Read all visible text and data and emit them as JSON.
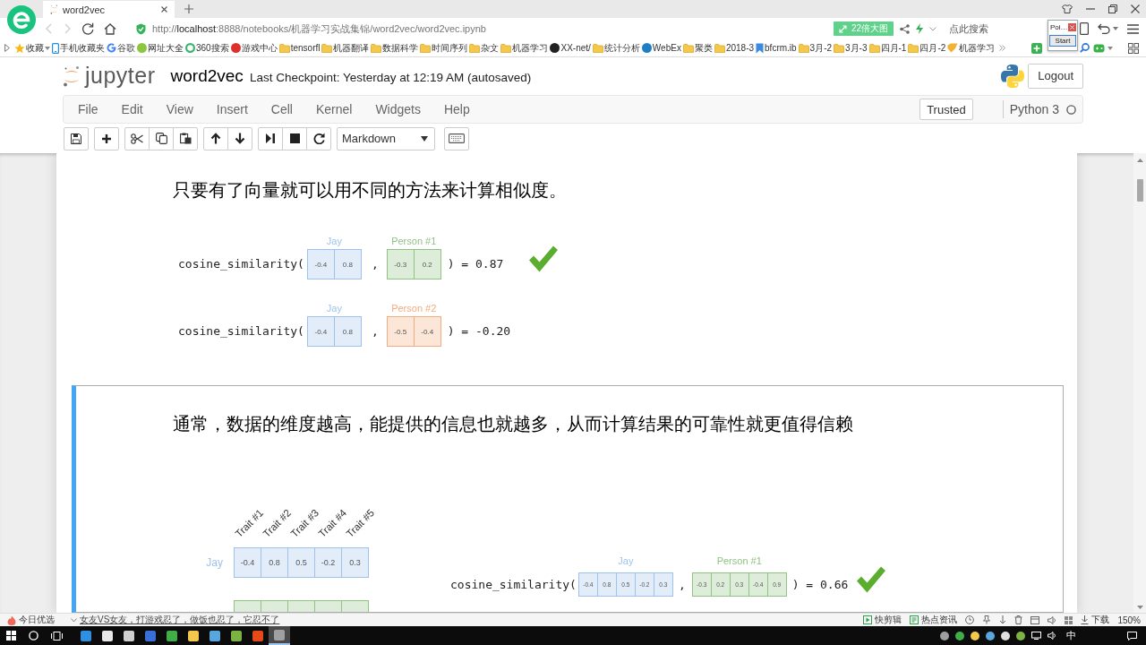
{
  "browser": {
    "tabs": [
      {
        "title": "word2vec",
        "selected": true
      }
    ],
    "navigation": {
      "back_disabled": true,
      "forward_disabled": true
    },
    "url": "http://**localhost**:8888/notebooks/机器学习实战集锦/word2vec/word2vec.ipynb",
    "promo": "22倍大图",
    "search": {
      "placeholder": "点此搜索"
    },
    "popup": {
      "title": "Poi…",
      "button": "Start"
    },
    "bookmarks": [
      {
        "kind": "star",
        "label": "收藏"
      },
      {
        "kind": "phone",
        "label": "手机收藏夹"
      },
      {
        "kind": "google",
        "label": "谷歌"
      },
      {
        "kind": "site",
        "label": "网址大全",
        "color": "#8cc63f"
      },
      {
        "kind": "ring",
        "label": "360搜索",
        "color": "#3cb371"
      },
      {
        "kind": "site",
        "label": "游戏中心",
        "color": "#e0302c"
      },
      {
        "kind": "folder",
        "label": "tensorfl"
      },
      {
        "kind": "folder",
        "label": "机器翻译"
      },
      {
        "kind": "folder",
        "label": "数据科学"
      },
      {
        "kind": "folder",
        "label": "时间序列"
      },
      {
        "kind": "folder",
        "label": "杂文"
      },
      {
        "kind": "folder",
        "label": "机器学习"
      },
      {
        "kind": "site",
        "label": "XX-net/",
        "color": "#222222"
      },
      {
        "kind": "folder",
        "label": "统计分析"
      },
      {
        "kind": "site",
        "label": "WebEx",
        "color": "#1f7fc4"
      },
      {
        "kind": "folder",
        "label": "聚类"
      },
      {
        "kind": "folder",
        "label": "2018-3"
      },
      {
        "kind": "ribbon",
        "label": "bfcrm.ib"
      },
      {
        "kind": "folder",
        "label": "3月-2"
      },
      {
        "kind": "folder",
        "label": "3月-3"
      },
      {
        "kind": "folder",
        "label": "四月-1"
      },
      {
        "kind": "folder",
        "label": "四月-2"
      },
      {
        "kind": "tag",
        "label": "机器学习"
      }
    ]
  },
  "notebook": {
    "logo": "jupyter",
    "name": "word2vec",
    "checkpoint": "Last Checkpoint: Yesterday at 12:19 AM (autosaved)",
    "logout": "Logout",
    "menu": [
      "File",
      "Edit",
      "View",
      "Insert",
      "Cell",
      "Kernel",
      "Widgets",
      "Help"
    ],
    "trusted": "Trusted",
    "kernel": {
      "name": "Python 3",
      "busy": false
    },
    "cell_type": "Markdown",
    "cells": [
      {
        "selected": false,
        "text": "只要有了向量就可以用不同的方法来计算相似度。",
        "figure": {
          "kind": "comparison",
          "rows": [
            {
              "function": "cosine_similarity(",
              "vectors": [
                {
                  "name": "Jay",
                  "color": "#9dc3ec",
                  "values": [
                    "-0.4",
                    "0.8"
                  ]
                },
                {
                  "name": "Person #1",
                  "color": "#8fc283",
                  "values": [
                    "-0.3",
                    "0.2"
                  ]
                }
              ],
              "separator": ",",
              "result": ") = 0.87",
              "match": true
            },
            {
              "function": "cosine_similarity(",
              "vectors": [
                {
                  "name": "Jay",
                  "color": "#9dc3ec",
                  "values": [
                    "-0.4",
                    "0.8"
                  ]
                },
                {
                  "name": "Person #2",
                  "color": "#f2ac7e",
                  "values": [
                    "-0.5",
                    "-0.4"
                  ]
                }
              ],
              "separator": ",",
              "result": ") = -0.20",
              "match": false
            }
          ]
        }
      },
      {
        "selected": true,
        "text": "通常，数据的维度越高，能提供的信息也就越多，从而计算结果的可靠性就更值得信赖",
        "figure": {
          "kind": "traits",
          "traits": [
            "Trait #1",
            "Trait #2",
            "Trait #3",
            "Trait #4",
            "Trait #5"
          ],
          "rows": [
            {
              "name": "Jay",
              "color": "#9dc3ec",
              "values": [
                "-0.4",
                "0.8",
                "0.5",
                "-0.2",
                "0.3"
              ]
            },
            {
              "color": "#8fc283"
            }
          ],
          "comparison": {
            "function": "cosine_similarity(",
            "vectors": [
              {
                "name": "Jay",
                "color": "#9dc3ec",
                "values": [
                  "-0.4",
                  "0.8",
                  "0.5",
                  "-0.2",
                  "0.3"
                ]
              },
              {
                "name": "Person #1",
                "color": "#8fc283",
                "values": [
                  "-0.3",
                  "0.2",
                  "0.3",
                  "-0.4",
                  "0.9"
                ]
              }
            ],
            "separator": ",",
            "result": ") = 0.66",
            "match": true
          }
        }
      }
    ]
  },
  "status_bar": {
    "left": [
      {
        "kind": "feed",
        "text": "今日优选"
      },
      {
        "kind": "headline",
        "text": "女友VS女友，打游戏忍了，做饭也忍了，它忍不了"
      }
    ],
    "right": [
      {
        "kind": "clip",
        "text": "快剪辑"
      },
      {
        "kind": "news",
        "text": "热点资讯"
      },
      {
        "kind": "download",
        "text": "下载"
      },
      {
        "kind": "zoom",
        "text": "150%"
      }
    ]
  },
  "taskbar": {
    "apps": [
      {
        "color": "#2f8fe0",
        "selected": false
      },
      {
        "color": "#e8e8e8",
        "selected": false
      },
      {
        "color": "#d0d0d0",
        "selected": false
      },
      {
        "color": "#3b6fd8",
        "selected": false
      },
      {
        "color": "#3fae49",
        "selected": false
      },
      {
        "color": "#f2c94c",
        "selected": false
      },
      {
        "color": "#5aa6df",
        "selected": false
      },
      {
        "color": "#7cb342",
        "selected": false
      },
      {
        "color": "#e64a19",
        "selected": false
      },
      {
        "color": "#a0a0a0",
        "selected": true
      }
    ],
    "ime": "中"
  }
}
